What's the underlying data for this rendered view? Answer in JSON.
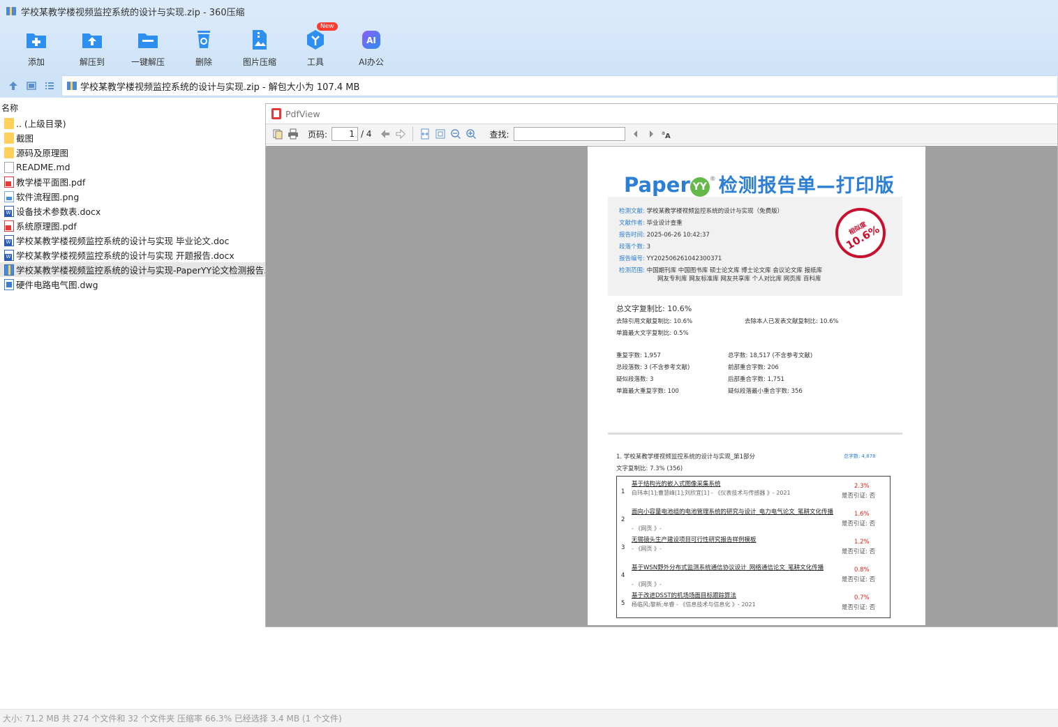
{
  "window": {
    "title": "学校某教学楼视频监控系统的设计与实现.zip - 360压缩"
  },
  "toolbar": {
    "buttons": [
      {
        "label": "添加",
        "icon": "add-icon"
      },
      {
        "label": "解压到",
        "icon": "extract-to-icon"
      },
      {
        "label": "一键解压",
        "icon": "one-click-extract-icon"
      },
      {
        "label": "删除",
        "icon": "delete-icon"
      },
      {
        "label": "图片压缩",
        "icon": "image-compress-icon"
      },
      {
        "label": "工具",
        "icon": "tools-icon",
        "badge": "New"
      },
      {
        "label": "AI办公",
        "icon": "ai-icon"
      }
    ]
  },
  "addressbar": {
    "path": "学校某教学楼视频监控系统的设计与实现.zip - 解包大小为 107.4 MB"
  },
  "filelist": {
    "header": "名称",
    "items": [
      {
        "name": ".. (上级目录)",
        "type": "folder"
      },
      {
        "name": "截图",
        "type": "folder"
      },
      {
        "name": "源码及原理图",
        "type": "folder"
      },
      {
        "name": "README.md",
        "type": "doc"
      },
      {
        "name": "教学楼平面图.pdf",
        "type": "pdf"
      },
      {
        "name": "软件流程图.png",
        "type": "png"
      },
      {
        "name": "设备技术参数表.docx",
        "type": "word"
      },
      {
        "name": "系统原理图.pdf",
        "type": "pdf"
      },
      {
        "name": "学校某教学楼视频监控系统的设计与实现 毕业论文.doc",
        "type": "word"
      },
      {
        "name": "学校某教学楼视频监控系统的设计与实现 开题报告.docx",
        "type": "word"
      },
      {
        "name": "学校某教学楼视频监控系统的设计与实现-PaperYY论文检测报告.zip",
        "type": "zip",
        "selected": true
      },
      {
        "name": "硬件电路电气图.dwg",
        "type": "dwg"
      }
    ]
  },
  "pdfview": {
    "title": "PdfView",
    "page_label": "页码:",
    "current_page": "1",
    "total_pages": "/ 4",
    "find_label": "查找:",
    "find_value": ""
  },
  "report": {
    "logo": "Paper",
    "logo_mark": "YY",
    "logo_reg": "®",
    "title": "检测报告单—打印版",
    "info": [
      {
        "key": "检测文献:",
        "value": "学校某教学楼视频监控系统的设计与实现（免费版）"
      },
      {
        "key": "文献作者:",
        "value": "毕业设计查重"
      },
      {
        "key": "报告时间:",
        "value": "2025-06-26 10:42:37"
      },
      {
        "key": "段落个数:",
        "value": "3"
      },
      {
        "key": "报告编号:",
        "value": "YY202506261042300371"
      },
      {
        "key": "检测范围:",
        "value": "中国期刊库  中国图书库  硕士论文库  博士论文库  会议论文库  报纸库"
      }
    ],
    "range_line2": "网友专利库  网友标准库  网友共享库  个人对比库  网页库  百科库",
    "seal_top": "相似度",
    "seal_value": "10.6%",
    "total_ratio": "总文字复制比: 10.6%",
    "ratio_excl_cite": "去除引用文献复制比: 10.6%",
    "ratio_excl_self": "去除本人已发表文献复制比: 10.6%",
    "ratio_max_single": "单篇最大文字复制比: 0.5%",
    "stats_left": [
      "重复字数: 1,957",
      "总段落数: 3 (不含参考文献)",
      "疑似段落数: 3",
      "单篇最大重复字数: 100"
    ],
    "stats_right": [
      "总字数: 18,517 (不含参考文献)",
      "前部重合字数: 206",
      "后部重合字数: 1,751",
      "疑似段落最小重合字数: 356"
    ],
    "section_title": "1. 学校某教学楼视频监控系统的设计与实现_第1部分",
    "section_total": "总字数: 4,878",
    "section_ratio": "文字复制比: 7.3% (356)",
    "sources": [
      {
        "num": "1",
        "title": "基于结构光的嵌入式图像采集系统",
        "meta": "白玮本[1];曹慧峰[1];刘欣宜[1] - 《仪表技术与传感器 》- 2021",
        "pct": "2.3%",
        "cite": "是否引证: 否"
      },
      {
        "num": "2",
        "title": "面向小容量电池组的电池管理系统的研究与设计_电力电气论文_笔耕文化传播",
        "meta": "- 《网页 》-",
        "pct": "1.6%",
        "cite": "是否引证: 否"
      },
      {
        "num": "3",
        "title": "无锡镜头生产建设项目可行性研究报告样例模板",
        "meta": "- 《网页 》-",
        "pct": "1.2%",
        "cite": "是否引证: 否"
      },
      {
        "num": "4",
        "title": "基于WSN野外分布式监测系统通信协议设计_网络通信论文_笔耕文化传播",
        "meta": "- 《网页 》-",
        "pct": "0.8%",
        "cite": "是否引证: 否"
      },
      {
        "num": "5",
        "title": "基于改进DSST的机场场面目标跟踪算法",
        "meta": "杨临风;黎新;牟睿 - 《信息技术与信息化 》- 2021",
        "pct": "0.7%",
        "cite": "是否引证: 否"
      }
    ]
  },
  "statusbar": {
    "text": "大小: 71.2 MB 共 274 个文件和 32 个文件夹 压缩率 66.3% 已经选择 3.4 MB (1 个文件)"
  },
  "colors": {
    "accent": "#2d7fd3",
    "toolbar_bg": "#d6e8fa",
    "selection": "#e6e6e6",
    "seal": "#c8102e",
    "pdf_bg": "#a0a0a0"
  }
}
